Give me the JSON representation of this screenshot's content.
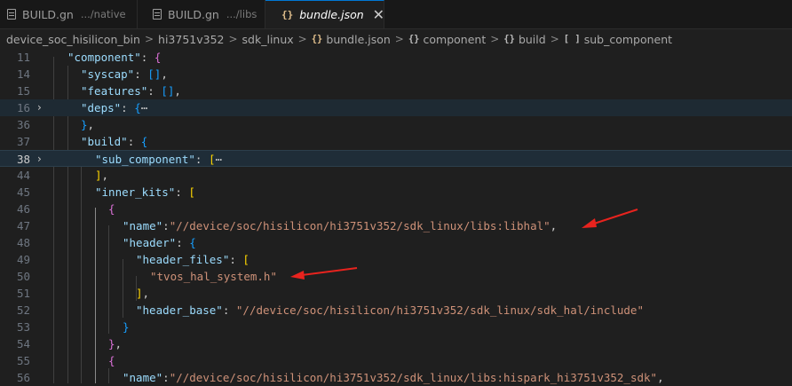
{
  "tabs": [
    {
      "name": "BUILD.gn",
      "desc": ".../native",
      "icon": "file-lines-icon"
    },
    {
      "name": "BUILD.gn",
      "desc": ".../libs",
      "icon": "file-lines-icon"
    },
    {
      "name": "bundle.json",
      "icon_text": "{}",
      "close": "✕",
      "active": true
    }
  ],
  "breadcrumb": {
    "items": [
      "device_soc_hisilicon_bin",
      "hi3751v352",
      "sdk_linux",
      "bundle.json",
      "component",
      "build",
      "sub_component"
    ],
    "separator": ">",
    "object_icon": "{}",
    "array_icon": "[ ]"
  },
  "editor": {
    "line_numbers": [
      "11",
      "14",
      "15",
      "16",
      "36",
      "37",
      "38",
      "44",
      "45",
      "46",
      "47",
      "48",
      "49",
      "50",
      "51",
      "52",
      "53",
      "54",
      "55",
      "56"
    ],
    "fold_glyph": "›",
    "ellipsis": "⋯",
    "strings": {
      "component": "\"component\"",
      "syscap": "\"syscap\"",
      "features": "\"features\"",
      "deps": "\"deps\"",
      "build": "\"build\"",
      "sub_component": "\"sub_component\"",
      "inner_kits": "\"inner_kits\"",
      "name": "\"name\"",
      "name_val_1": "\"//device/soc/hisilicon/hi3751v352/sdk_linux/libs:libhal\"",
      "header": "\"header\"",
      "header_files": "\"header_files\"",
      "header_file_1": "\"tvos_hal_system.h\"",
      "header_base": "\"header_base\"",
      "header_base_val": "\"//device/soc/hisilicon/hi3751v352/sdk_linux/sdk_hal/include\"",
      "name_val_2": "\"//device/soc/hisilicon/hi3751v352/sdk_linux/libs:hispark_hi3751v352_sdk\""
    }
  },
  "colors": {
    "annotation_arrow": "#e8231e",
    "key": "#9cdcfe",
    "string": "#ce9178",
    "bracket_gold": "#ffd700",
    "bracket_purple": "#da70d6",
    "bracket_blue": "#179fff"
  }
}
